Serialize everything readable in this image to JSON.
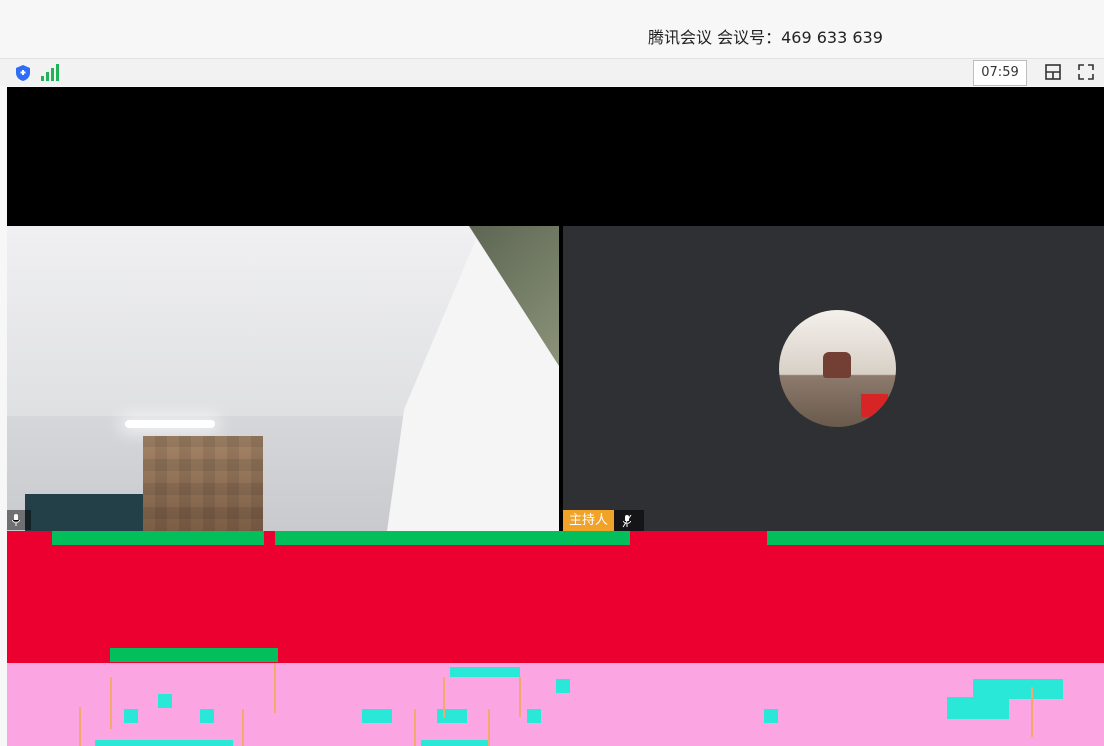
{
  "window": {
    "title": "腾讯会议 会议号：469 633 639"
  },
  "toolbar": {
    "timer": "07:59",
    "icons": [
      "shield-icon",
      "signal-icon",
      "layout-icon",
      "fullscreen-icon"
    ]
  },
  "participants": {
    "left": {
      "name": ""
    },
    "right": {
      "host_label": "主持人",
      "name": ""
    }
  },
  "colors": {
    "accent_green": "#20b35a",
    "host_badge": "#f1a228",
    "glitch_red": "#eb0030",
    "glitch_pink": "#fba6e3",
    "glitch_cyan": "#29e8d8"
  }
}
